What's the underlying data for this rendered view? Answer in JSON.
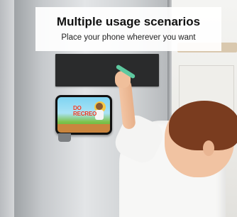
{
  "banner": {
    "title": "Multiple usage scenarios",
    "subtitle": "Place your phone wherever you want"
  },
  "phone_screen": {
    "title_line1": "DO",
    "title_line2": "RECREO"
  },
  "colors": {
    "chalkboard": "#2a2b2c",
    "marker": "#5ec9a0",
    "fridge": "#c6c9cc",
    "shirt": "#f7f7f6",
    "hair": "#7a3c1f"
  }
}
